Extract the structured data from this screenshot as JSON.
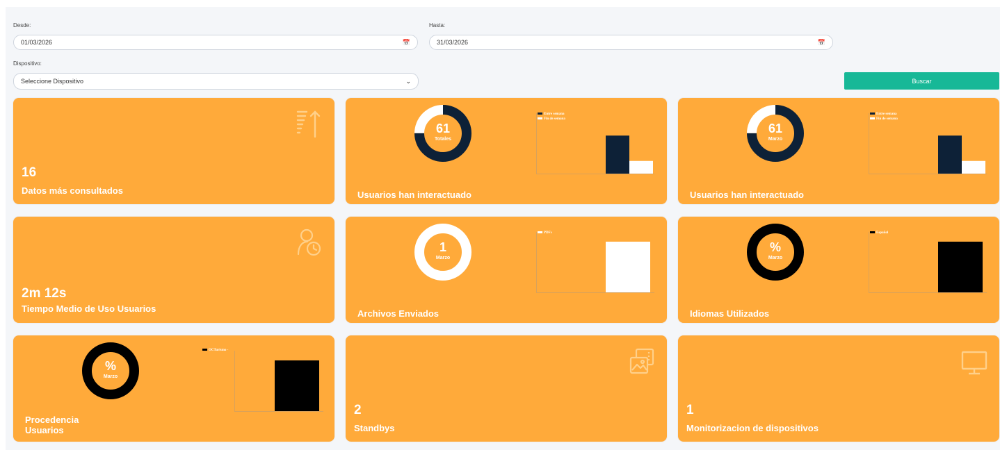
{
  "colors": {
    "card": "#ffaa3a",
    "button": "#17b897",
    "navy": "#0d2137",
    "white": "#ffffff",
    "black": "#000000"
  },
  "filters": {
    "desde_label": "Desde:",
    "desde_value": "01/03/2026",
    "hasta_label": "Hasta:",
    "hasta_value": "31/03/2026",
    "dispositivo_label": "Dispositivo:",
    "dispositivo_value": "Seleccione Dispositivo",
    "buscar_label": "Buscar"
  },
  "cards": {
    "datos": {
      "value": "16",
      "title": "Datos más consultados",
      "icon": "sort-arrow-up-icon"
    },
    "usuarios_totales": {
      "value": "61",
      "sub": "Totales",
      "title": "Usuarios han interactuado"
    },
    "usuarios_marzo": {
      "value": "61",
      "sub": "Marzo",
      "title": "Usuarios han interactuado"
    },
    "tiempo": {
      "value": "2m 12s",
      "title": "Tiempo Medio de Uso Usuarios",
      "icon": "user-clock-icon"
    },
    "archivos": {
      "value": "1",
      "sub": "Marzo",
      "title": "Archivos Enviados"
    },
    "idiomas": {
      "value": "%",
      "sub": "Marzo",
      "title": "Idiomas Utilizados"
    },
    "procedencia": {
      "value": "%",
      "sub": "Marzo",
      "title_line1": "Procedencia",
      "title_line2": "Usuarios"
    },
    "standbys": {
      "value": "2",
      "title": "Standbys",
      "icon": "images-icon"
    },
    "monitor": {
      "value": "1",
      "title": "Monitorizacion de dispositivos",
      "icon": "monitor-icon"
    }
  },
  "chart_data": [
    {
      "type": "pie",
      "variant": "donut",
      "card": "usuarios_totales",
      "segments": [
        {
          "label": "Entre semana",
          "value": 0.75,
          "color": "#0d2137"
        },
        {
          "label": "Fin de semana",
          "value": 0.25,
          "color": "#ffffff"
        }
      ]
    },
    {
      "type": "bar",
      "card": "usuarios_totales",
      "categories": [
        "Entre semana",
        "Fin de semana"
      ],
      "values": [
        0.75,
        0.25
      ],
      "colors": [
        "#0d2137",
        "#ffffff"
      ],
      "legend": [
        "Entre semana",
        "Fin de semana"
      ]
    },
    {
      "type": "pie",
      "variant": "donut",
      "card": "usuarios_marzo",
      "segments": [
        {
          "label": "Entre semana",
          "value": 0.75,
          "color": "#0d2137"
        },
        {
          "label": "Fin de semana",
          "value": 0.25,
          "color": "#ffffff"
        }
      ]
    },
    {
      "type": "bar",
      "card": "usuarios_marzo",
      "categories": [
        "Entre semana",
        "Fin de semana"
      ],
      "values": [
        0.75,
        0.25
      ],
      "colors": [
        "#0d2137",
        "#ffffff"
      ],
      "legend": [
        "Entre semana",
        "Fin de semana"
      ]
    },
    {
      "type": "pie",
      "variant": "donut",
      "card": "archivos",
      "segments": [
        {
          "label": "PDFs",
          "value": 1,
          "color": "#ffffff"
        }
      ]
    },
    {
      "type": "bar",
      "card": "archivos",
      "categories": [
        "PDFs"
      ],
      "values": [
        1
      ],
      "colors": [
        "#ffffff"
      ],
      "legend": [
        "PDFs"
      ]
    },
    {
      "type": "pie",
      "variant": "donut",
      "card": "idiomas",
      "segments": [
        {
          "label": "Español",
          "value": 1,
          "color": "#000000"
        }
      ]
    },
    {
      "type": "bar",
      "card": "idiomas",
      "categories": [
        "Español"
      ],
      "values": [
        1
      ],
      "colors": [
        "#000000"
      ],
      "legend": [
        "Español"
      ]
    },
    {
      "type": "pie",
      "variant": "donut",
      "card": "procedencia",
      "segments": [
        {
          "label": "OCTurismo -",
          "value": 1,
          "color": "#000000"
        }
      ]
    },
    {
      "type": "bar",
      "card": "procedencia",
      "categories": [
        "OCTurismo -"
      ],
      "values": [
        1
      ],
      "colors": [
        "#000000"
      ],
      "legend": [
        "OCTurismo -"
      ]
    }
  ]
}
